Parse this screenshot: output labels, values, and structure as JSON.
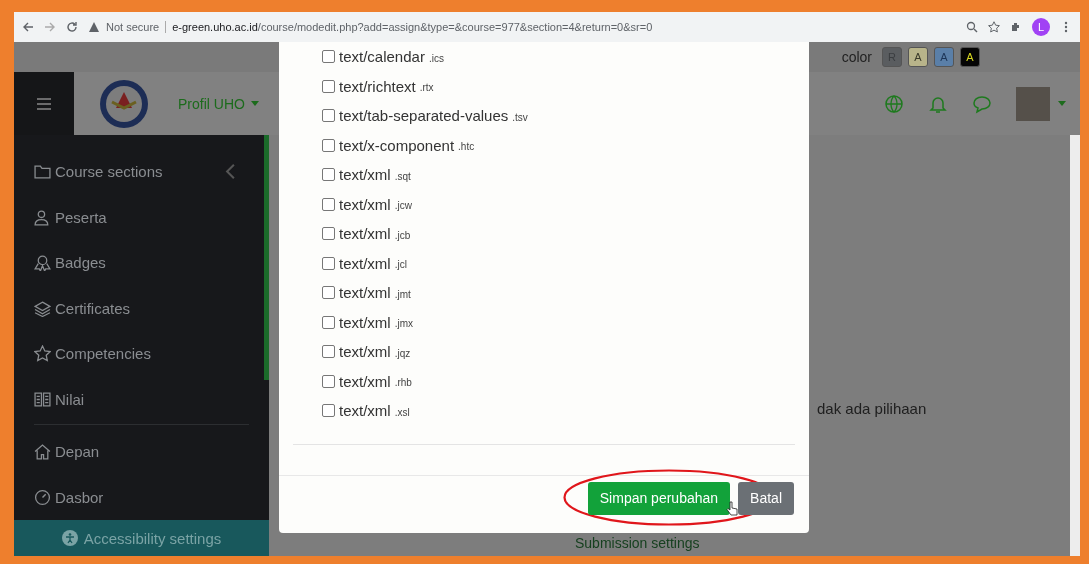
{
  "browser": {
    "security": "Not secure",
    "url_host": "e-green.uho.ac.id",
    "url_path": "/course/modedit.php?add=assign&type=&course=977&section=4&return=0&sr=0",
    "profile_letter": "L"
  },
  "color_bar": {
    "label": "color",
    "swatches": [
      {
        "label": "R"
      },
      {
        "label": "A"
      },
      {
        "label": "A"
      },
      {
        "label": "A"
      }
    ]
  },
  "header": {
    "site_menu": "Profil UHO"
  },
  "sidebar": {
    "items": [
      {
        "label": "Course sections",
        "collapsible": true
      },
      {
        "label": "Peserta",
        "collapsible": false
      },
      {
        "label": "Badges",
        "collapsible": false
      },
      {
        "label": "Certificates",
        "collapsible": false
      },
      {
        "label": "Competencies",
        "collapsible": false
      },
      {
        "label": "Nilai",
        "collapsible": false
      }
    ],
    "secondary": [
      {
        "label": "Depan",
        "collapsible": false
      },
      {
        "label": "Dasbor",
        "collapsible": false
      }
    ],
    "accessibility": "Accessibility settings"
  },
  "page": {
    "partial_text": "dak ada pilihaan",
    "section_heading": "Submission settings"
  },
  "modal": {
    "file_types": [
      {
        "type": "text/calendar",
        "ext": ".ics",
        "checked": false
      },
      {
        "type": "text/richtext",
        "ext": ".rtx",
        "checked": false
      },
      {
        "type": "text/tab-separated-values",
        "ext": ".tsv",
        "checked": false
      },
      {
        "type": "text/x-component",
        "ext": ".htc",
        "checked": false
      },
      {
        "type": "text/xml",
        "ext": ".sqt",
        "checked": false
      },
      {
        "type": "text/xml",
        "ext": ".jcw",
        "checked": false
      },
      {
        "type": "text/xml",
        "ext": ".jcb",
        "checked": false
      },
      {
        "type": "text/xml",
        "ext": ".jcl",
        "checked": false
      },
      {
        "type": "text/xml",
        "ext": ".jmt",
        "checked": false
      },
      {
        "type": "text/xml",
        "ext": ".jmx",
        "checked": false
      },
      {
        "type": "text/xml",
        "ext": ".jqz",
        "checked": false
      },
      {
        "type": "text/xml",
        "ext": ".rhb",
        "checked": false
      },
      {
        "type": "text/xml",
        "ext": ".xsl",
        "checked": false
      }
    ],
    "buttons": [
      {
        "label": "Simpan perubahan",
        "kind": "primary",
        "highlighted": true
      },
      {
        "label": "Batal",
        "kind": "secondary",
        "highlighted": false
      }
    ]
  }
}
